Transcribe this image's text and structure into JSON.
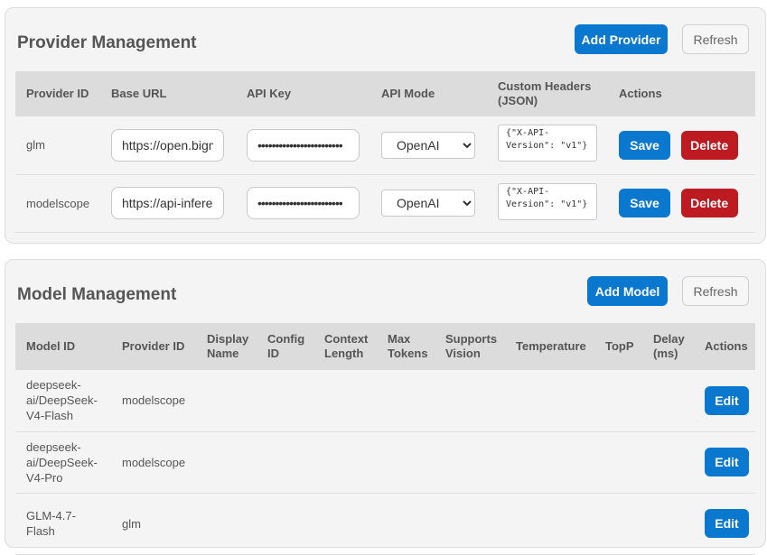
{
  "providers": {
    "title": "Provider Management",
    "add_label": "Add Provider",
    "refresh_label": "Refresh",
    "columns": [
      "Provider ID",
      "Base URL",
      "API Key",
      "API Mode",
      "Custom Headers (JSON)",
      "Actions"
    ],
    "rows": [
      {
        "id": "glm",
        "base_url": "https://open.bigmodel.cn",
        "api_key": "••••••••••••••••••••••••",
        "mode": "OpenAI",
        "headers": "{\"X-API-Version\": \"v1\"}",
        "save": "Save",
        "delete": "Delete"
      },
      {
        "id": "modelscope",
        "base_url": "https://api-inference.modelscope.cn",
        "api_key": "••••••••••••••••••••••••",
        "mode": "OpenAI",
        "headers": "{\"X-API-Version\": \"v1\"}",
        "save": "Save",
        "delete": "Delete"
      }
    ],
    "mode_options": [
      "OpenAI"
    ]
  },
  "models": {
    "title": "Model Management",
    "add_label": "Add Model",
    "refresh_label": "Refresh",
    "columns": [
      "Model ID",
      "Provider ID",
      "Display Name",
      "Config ID",
      "Context Length",
      "Max Tokens",
      "Supports Vision",
      "Temperature",
      "TopP",
      "Delay (ms)",
      "Actions"
    ],
    "rows": [
      {
        "model_id": "deepseek-ai/DeepSeek-V4-Flash",
        "provider_id": "modelscope",
        "edit": "Edit"
      },
      {
        "model_id": "deepseek-ai/DeepSeek-V4-Pro",
        "provider_id": "modelscope",
        "edit": "Edit"
      },
      {
        "model_id": "GLM-4.7-Flash",
        "provider_id": "glm",
        "edit": "Edit"
      }
    ]
  }
}
